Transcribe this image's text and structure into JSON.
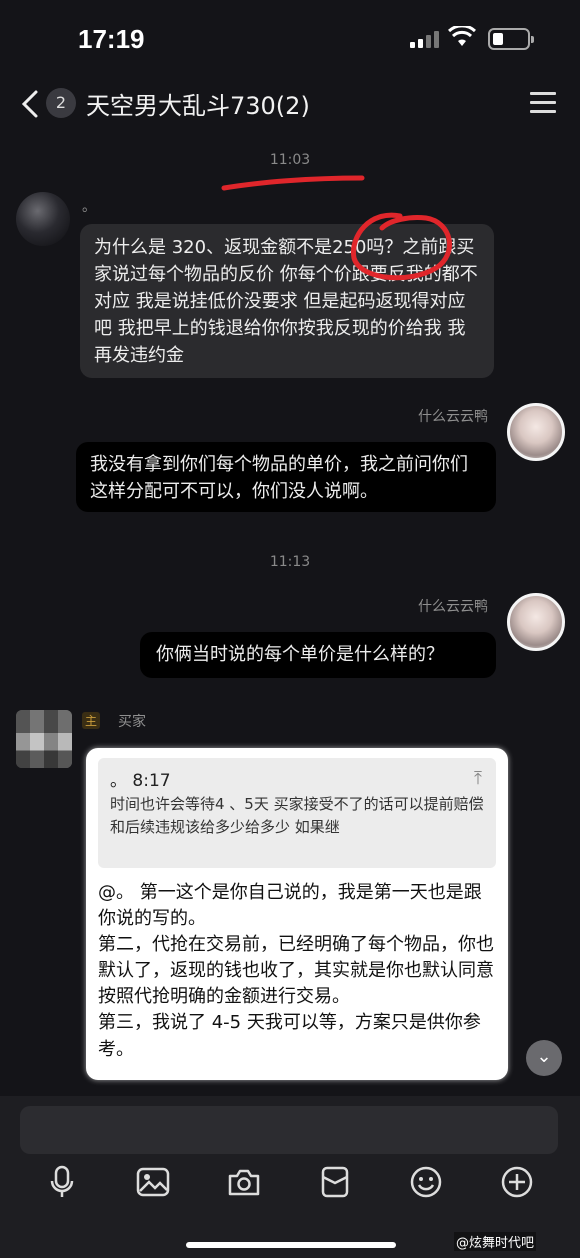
{
  "status_bar": {
    "time": "17:19"
  },
  "header": {
    "unread_count": "2",
    "title": "天空男大乱斗730(2)"
  },
  "messages": {
    "ts1": "11:03",
    "m1_name": "。",
    "m1_text": "为什么是 320、返现金额不是250吗？之前跟买家说过每个物品的反价 你每个价跟要反我的都不对应  我是说挂低价没要求 但是起码返现得对应吧 我把早上的钱退给你你按我反现的价给我 我再发违约金",
    "m2_name": "什么云云鸭",
    "m2_text": "我没有拿到你们每个物品的单价，我之前问你们这样分配可不可以，你们没人说啊。",
    "ts2": "11:13",
    "m3_name": "什么云云鸭",
    "m3_text": "你俩当时说的每个单价是什么样的？",
    "m4_tag": "主",
    "m4_name": "买家",
    "quote_head": "。 8:17",
    "quote_text": "时间也许会等待4 、5天 买家接受不了的话可以提前赔偿和后续违规该给多少给多少 如果继",
    "reply_text": "@。 第一这个是你自己说的，我是第一天也是跟你说的写的。\n第二，代抢在交易前，已经明确了每个物品，你也默认了，返现的钱也收了，其实就是你也默认同意按照代抢明确的金额进行交易。\n第三，我说了 4-5 天我可以等，方案只是供你参考。"
  },
  "watermark": "@炫舞时代吧",
  "colors": {
    "annotation_red": "#e0262b",
    "background": "#141418"
  }
}
